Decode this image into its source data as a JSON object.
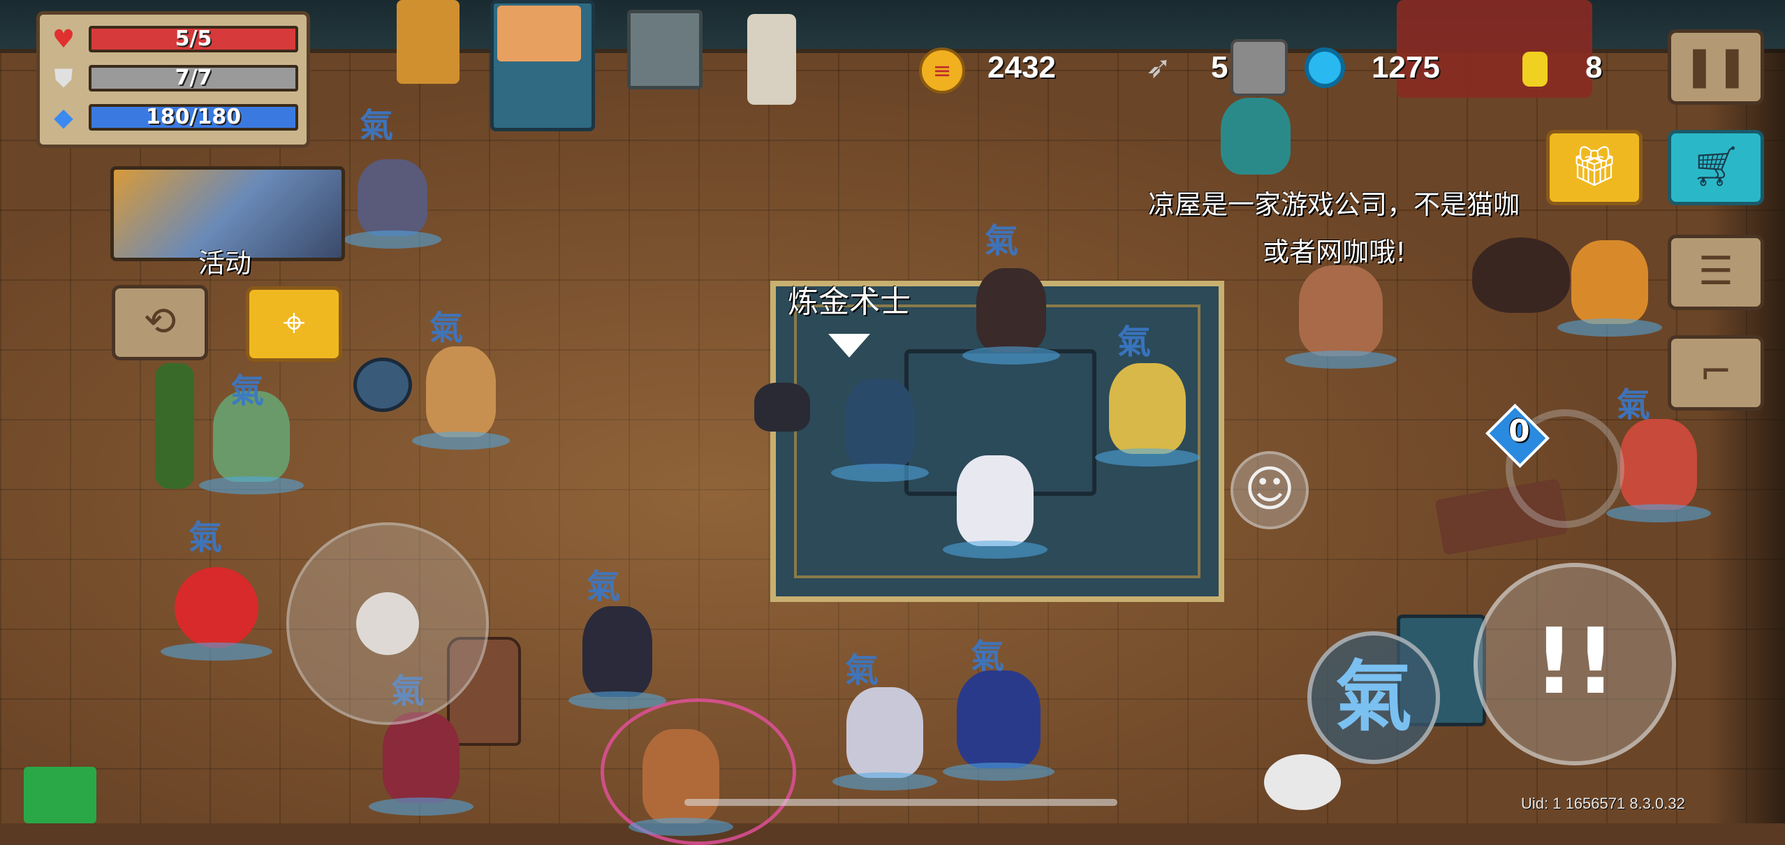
{
  "hud": {
    "hp": "5/5",
    "armor": "7/7",
    "energy": "180/180",
    "hp_fill": 1.0,
    "armor_fill": 1.0,
    "energy_fill": 1.0,
    "gold": "2432",
    "fish": "5",
    "gems": "1275",
    "tokens": "8"
  },
  "event": {
    "label": "活动"
  },
  "npc": {
    "name_tag": "炼金术士",
    "dialog_line1": "凉屋是一家游戏公司，不是猫咖",
    "dialog_line2": "或者网咖哦!"
  },
  "controls": {
    "skill_charge": "0",
    "qi_glyph": "氣",
    "attack_glyph": "!!"
  },
  "footer": {
    "uid": "Uid: 1 1656571 8.3.0.32"
  },
  "icons": {
    "heart": "heart-icon",
    "shield": "shield-icon",
    "energy": "diamond-icon",
    "gold": "coin-icon",
    "fish": "fish-icon",
    "gem": "gem-icon",
    "token": "token-icon",
    "pause": "pause-icon",
    "gift": "gift-icon",
    "shop": "cart-icon",
    "profile": "profile-card-icon",
    "stairs": "stairs-icon",
    "swap": "swap-icon",
    "location": "location-pin-icon",
    "emote": "smile-icon"
  },
  "colors": {
    "hp_bar": "#d63a3a",
    "armor_bar": "#9a9a9a",
    "energy_bar": "#3a7ae0",
    "gold_coin": "#f0b020",
    "gem": "#2ab8f0"
  }
}
